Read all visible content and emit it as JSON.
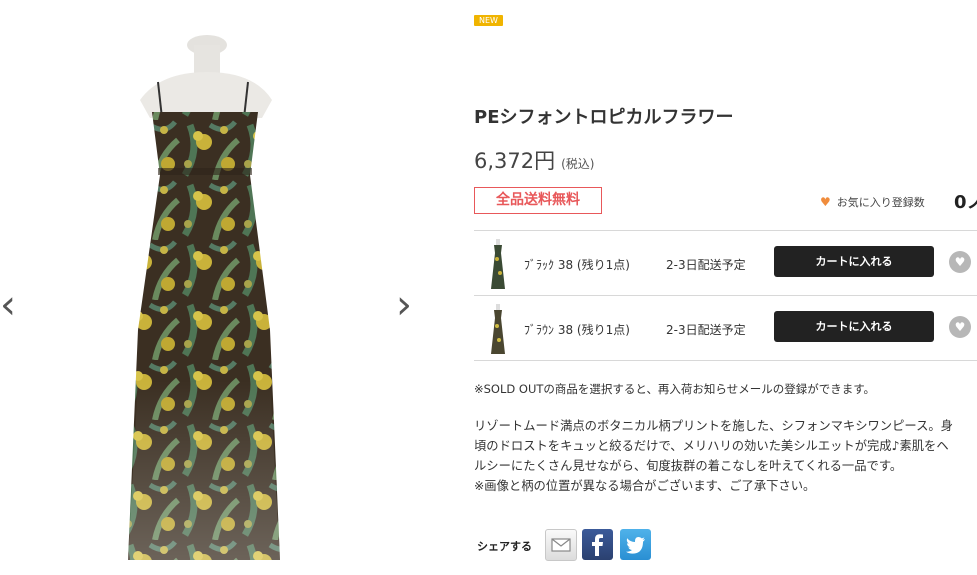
{
  "gallery": {
    "prev_label": "‹",
    "next_label": "›"
  },
  "product": {
    "badge": "NEW",
    "title": "PEシフォントロピカルフラワー",
    "price": "6,372円",
    "tax_note": "(税込)",
    "shipping_label": "全品送料無料",
    "favorite_label": "お気に入り登録数",
    "favorite_count": "0ノ"
  },
  "variants": [
    {
      "label": "ﾌﾞﾗｯｸ 38 (残り1点)",
      "delivery": "2-3日配送予定",
      "cart_label": "カートに入れる"
    },
    {
      "label": "ﾌﾞﾗｳﾝ 38 (残り1点)",
      "delivery": "2-3日配送予定",
      "cart_label": "カートに入れる"
    }
  ],
  "soldout_note": "※SOLD OUTの商品を選択すると、再入荷お知らせメールの登録ができます。",
  "description": [
    "リゾートムード満点のボタニカル柄プリントを施した、シフォンマキシワンピース。身",
    "頃のドロストをキュッと絞るだけで、メリハリの効いた美シルエットが完成♪素肌をヘ",
    "ルシーにたくさん見せながら、旬度抜群の着こなしを叶えてくれる一品です。",
    "※画像と柄の位置が異なる場合がございます、ご了承下さい。"
  ],
  "share": {
    "label": "シェアする"
  },
  "colors": {
    "badge": "#f0b400",
    "shipping": "#e8585a",
    "cart_button": "#222222",
    "heart": "#f08c3c"
  },
  "icons": [
    "chevron-left-icon",
    "chevron-right-icon",
    "heart-icon",
    "mail-icon",
    "facebook-icon",
    "twitter-icon"
  ]
}
